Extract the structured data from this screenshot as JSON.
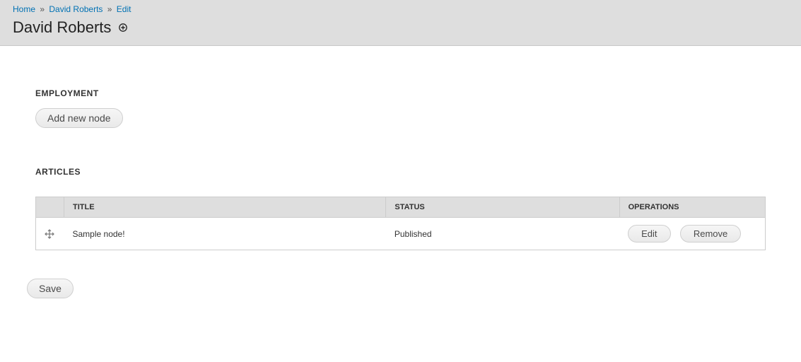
{
  "breadcrumb": {
    "home": "Home",
    "entity": "David Roberts",
    "current": "Edit",
    "separator": "»"
  },
  "page_title": "David Roberts",
  "sections": {
    "employment": {
      "heading": "EMPLOYMENT",
      "add_button": "Add new node"
    },
    "articles": {
      "heading": "ARTICLES",
      "columns": {
        "title": "TITLE",
        "status": "STATUS",
        "operations": "OPERATIONS"
      },
      "rows": [
        {
          "title": "Sample node!",
          "status": "Published",
          "ops": {
            "edit": "Edit",
            "remove": "Remove"
          }
        }
      ]
    }
  },
  "actions": {
    "save": "Save"
  }
}
